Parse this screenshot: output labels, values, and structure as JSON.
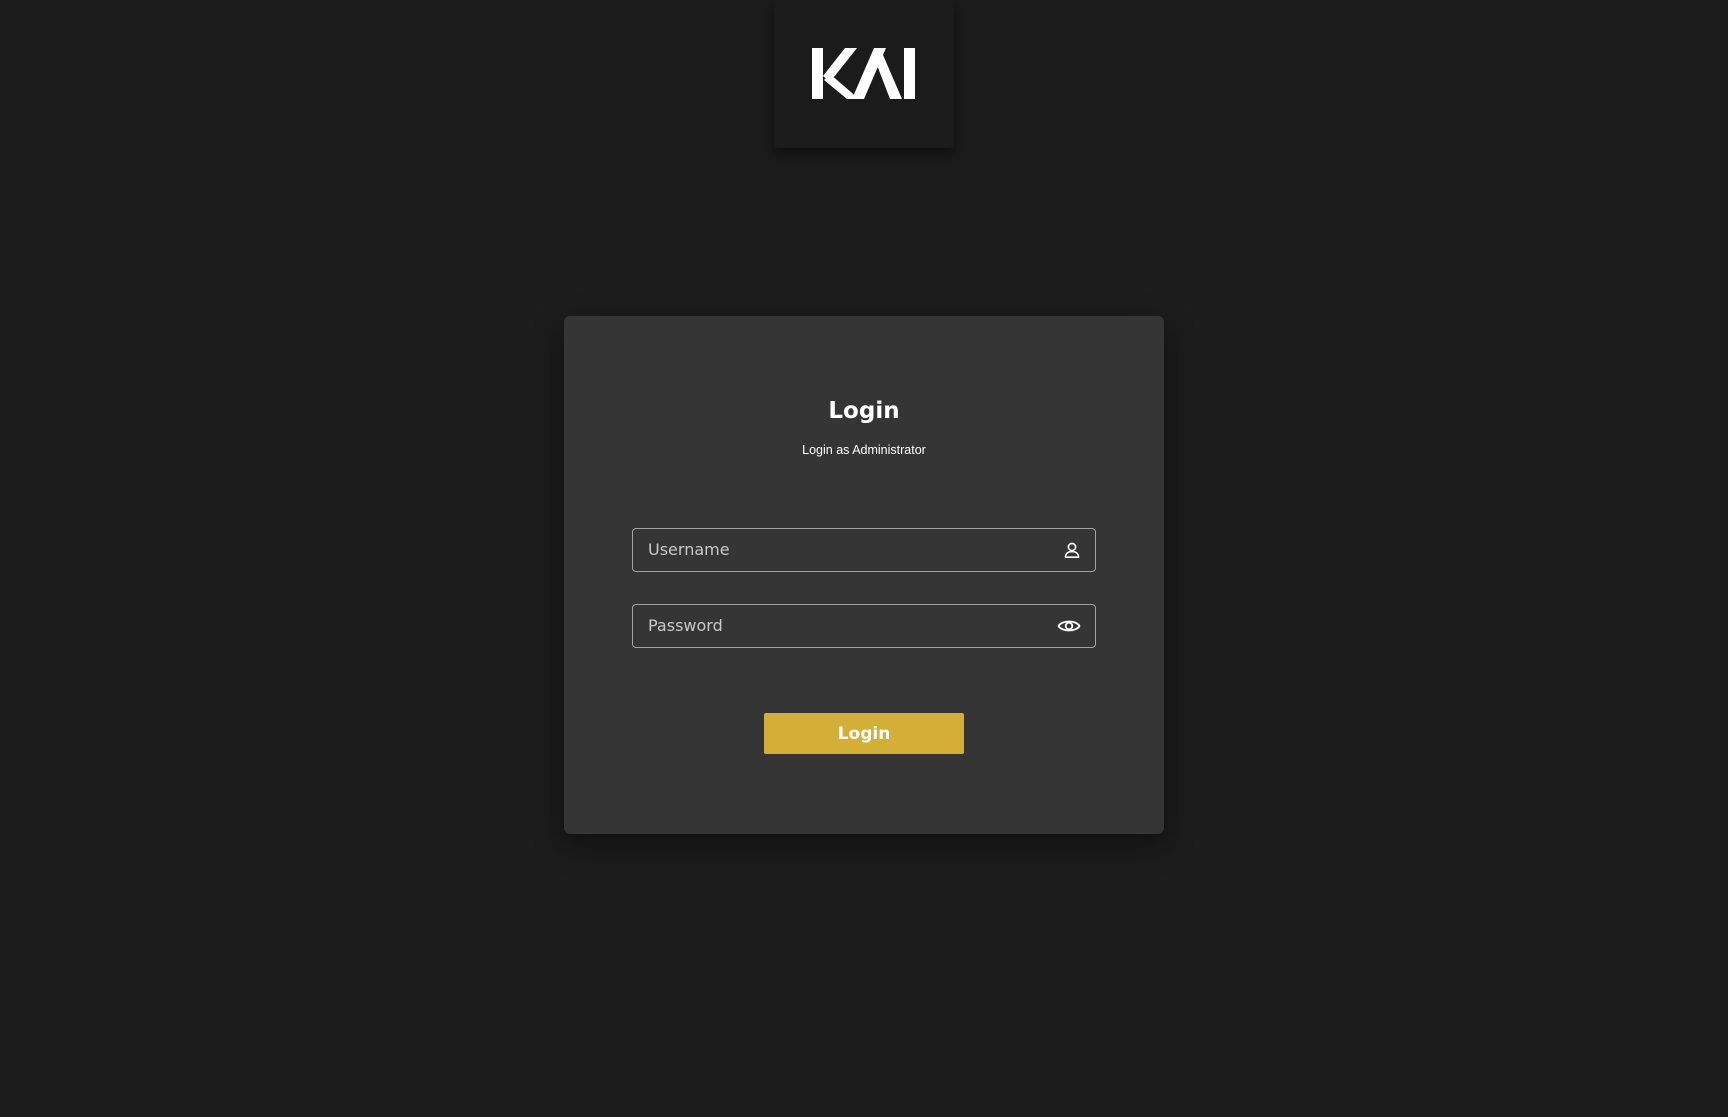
{
  "logo": {
    "text": "KAI",
    "icon": "kai-logo"
  },
  "login_card": {
    "title": "Login",
    "subtitle": "Login as Administrator",
    "username": {
      "value": "",
      "placeholder": "Username",
      "icon": "user-icon"
    },
    "password": {
      "value": "",
      "placeholder": "Password",
      "icon": "eye-icon"
    },
    "submit_label": "Login"
  },
  "colors": {
    "background": "#1c1c1c",
    "card": "#353535",
    "accent": "#d4af37",
    "text": "#ffffff",
    "field_border": "#a4a4a4"
  }
}
